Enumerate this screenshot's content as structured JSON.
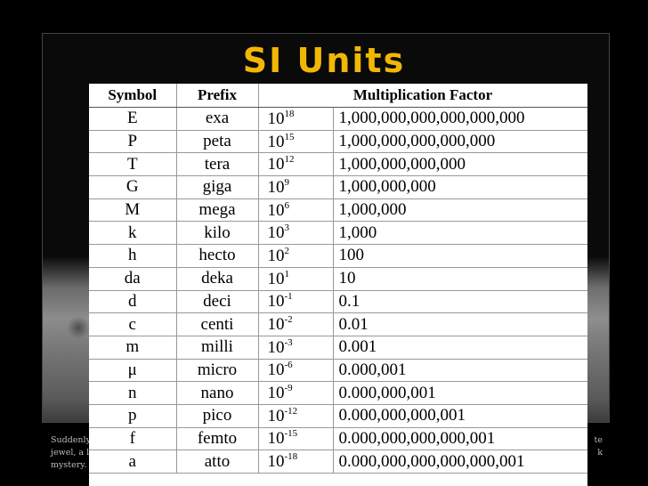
{
  "slide": {
    "title": "SI Units"
  },
  "caption": {
    "lines": [
      "Suddenly,",
      "jewel, a lig",
      "mystery. It"
    ],
    "right_lines": [
      "te",
      "k"
    ]
  },
  "table": {
    "headers": {
      "symbol": "Symbol",
      "prefix": "Prefix",
      "factor": "Multiplication Factor"
    },
    "rows": [
      {
        "symbol": "E",
        "prefix": "exa",
        "base": "10",
        "exp": "18",
        "value": "1,000,000,000,000,000,000"
      },
      {
        "symbol": "P",
        "prefix": "peta",
        "base": "10",
        "exp": "15",
        "value": "1,000,000,000,000,000"
      },
      {
        "symbol": "T",
        "prefix": "tera",
        "base": "10",
        "exp": "12",
        "value": "1,000,000,000,000"
      },
      {
        "symbol": "G",
        "prefix": "giga",
        "base": "10",
        "exp": "9",
        "value": "1,000,000,000"
      },
      {
        "symbol": "M",
        "prefix": "mega",
        "base": "10",
        "exp": "6",
        "value": "1,000,000"
      },
      {
        "symbol": "k",
        "prefix": "kilo",
        "base": "10",
        "exp": "3",
        "value": "1,000"
      },
      {
        "symbol": "h",
        "prefix": "hecto",
        "base": "10",
        "exp": "2",
        "value": "100"
      },
      {
        "symbol": "da",
        "prefix": "deka",
        "base": "10",
        "exp": "1",
        "value": "10"
      },
      {
        "symbol": "d",
        "prefix": "deci",
        "base": "10",
        "exp": "-1",
        "value": "0.1"
      },
      {
        "symbol": "c",
        "prefix": "centi",
        "base": "10",
        "exp": "-2",
        "value": "0.01"
      },
      {
        "symbol": "m",
        "prefix": "milli",
        "base": "10",
        "exp": "-3",
        "value": "0.001"
      },
      {
        "symbol": "μ",
        "prefix": "micro",
        "base": "10",
        "exp": "-6",
        "value": "0.000,001"
      },
      {
        "symbol": "n",
        "prefix": "nano",
        "base": "10",
        "exp": "-9",
        "value": "0.000,000,001"
      },
      {
        "symbol": "p",
        "prefix": "pico",
        "base": "10",
        "exp": "-12",
        "value": "0.000,000,000,001"
      },
      {
        "symbol": "f",
        "prefix": "femto",
        "base": "10",
        "exp": "-15",
        "value": "0.000,000,000,000,001"
      },
      {
        "symbol": "a",
        "prefix": "atto",
        "base": "10",
        "exp": "-18",
        "value": "0.000,000,000,000,000,001"
      }
    ]
  }
}
